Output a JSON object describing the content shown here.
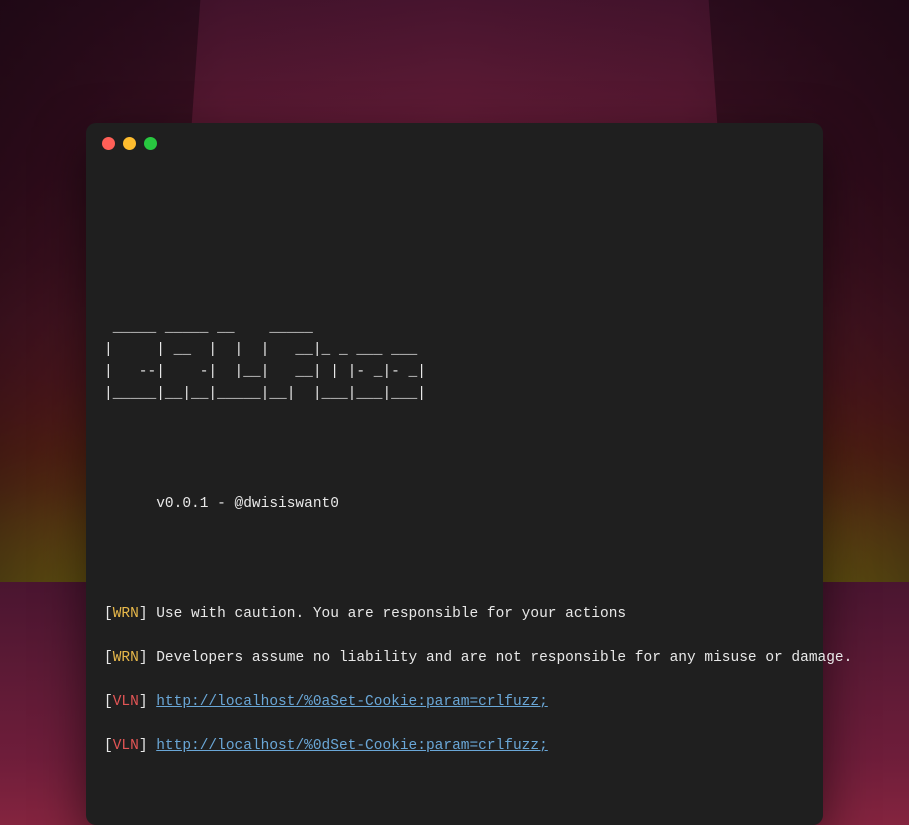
{
  "banner": {
    "lines": [
      " _____ _____ __    _____             ",
      "|     | __  |  |  |   __|_ _ ___ ___ ",
      "|   --|    -|  |__|   __| | |- _|- _|",
      "|_____|__|__|_____|__|  |___|___|___|"
    ],
    "version_line": "      v0.0.1 - @dwisiswant0"
  },
  "tags": {
    "wrn": "WRN",
    "vln": "VLN"
  },
  "messages": {
    "wrn1": " Use with caution. You are responsible for your actions",
    "wrn2": " Developers assume no liability and are not responsible for any misuse or damage.",
    "vln1_url": "http://localhost/%0aSet-Cookie:param=crlfuzz;",
    "vln2_url": "http://localhost/%0dSet-Cookie:param=crlfuzz;"
  }
}
